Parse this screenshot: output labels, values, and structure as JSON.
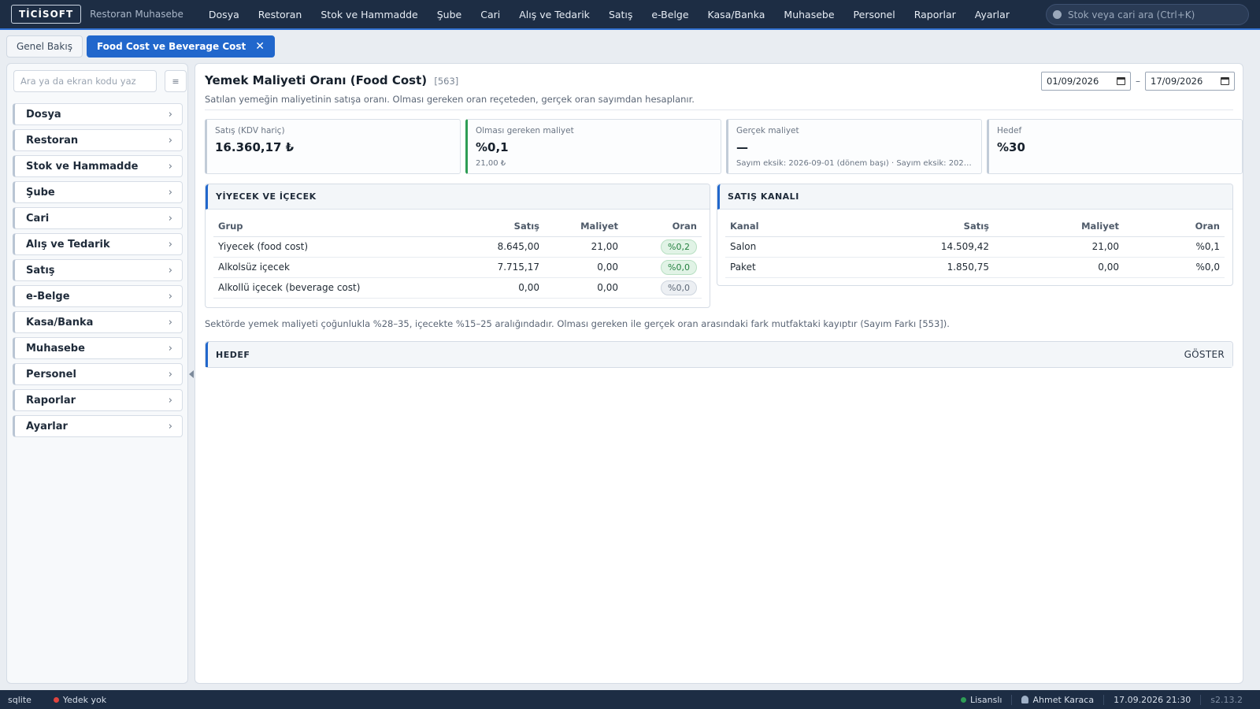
{
  "app": {
    "logo": "TİCİSOFT",
    "subtitle": "Restoran Muhasebe"
  },
  "topnav": [
    "Dosya",
    "Restoran",
    "Stok ve Hammadde",
    "Şube",
    "Cari",
    "Alış ve Tedarik",
    "Satış",
    "e-Belge",
    "Kasa/Banka",
    "Muhasebe",
    "Personel",
    "Raporlar",
    "Ayarlar"
  ],
  "search": {
    "placeholder": "Stok veya cari ara (Ctrl+K)"
  },
  "tabs": {
    "overview": "Genel Bakış",
    "active": "Food Cost ve Beverage Cost",
    "close": "✕"
  },
  "sidebar": {
    "search_placeholder": "Ara ya da ekran kodu yaz",
    "items": [
      "Dosya",
      "Restoran",
      "Stok ve Hammadde",
      "Şube",
      "Cari",
      "Alış ve Tedarik",
      "Satış",
      "e-Belge",
      "Kasa/Banka",
      "Muhasebe",
      "Personel",
      "Raporlar",
      "Ayarlar"
    ]
  },
  "page": {
    "title": "Yemek Maliyeti Oranı (Food Cost)",
    "code": "[563]",
    "subtitle": "Satılan yemeğin maliyetinin satışa oranı. Olması gereken oran reçeteden, gerçek oran sayımdan hesaplanır.",
    "date_from": "01/09/2026",
    "date_to": "17/09/2026",
    "date_sep": "–"
  },
  "kpis": [
    {
      "label": "Satış (KDV hariç)",
      "value": "16.360,17 ₺",
      "note": ""
    },
    {
      "label": "Olması gereken maliyet",
      "value": "%0,1",
      "note": "21,00 ₺"
    },
    {
      "label": "Gerçek maliyet",
      "value": "—",
      "note": "Sayım eksik: 2026-09-01 (dönem başı) · Sayım eksik: 2026-..."
    },
    {
      "label": "Hedef",
      "value": "%30",
      "note": ""
    }
  ],
  "food_table": {
    "title": "YİYECEK VE İÇECEK",
    "headers": [
      "Grup",
      "Satış",
      "Maliyet",
      "Oran"
    ],
    "rows": [
      {
        "group": "Yiyecek (food cost)",
        "sales": "8.645,00",
        "cost": "21,00",
        "ratio": "%0,2"
      },
      {
        "group": "Alkolsüz içecek",
        "sales": "7.715,17",
        "cost": "0,00",
        "ratio": "%0,0"
      },
      {
        "group": "Alkollü içecek (beverage cost)",
        "sales": "0,00",
        "cost": "0,00",
        "ratio": "%0,0"
      }
    ]
  },
  "channel_table": {
    "title": "SATIŞ KANALI",
    "headers": [
      "Kanal",
      "Satış",
      "Maliyet",
      "Oran"
    ],
    "rows": [
      {
        "channel": "Salon",
        "sales": "14.509,42",
        "cost": "21,00",
        "ratio": "%0,1"
      },
      {
        "channel": "Paket",
        "sales": "1.850,75",
        "cost": "0,00",
        "ratio": "%0,0"
      }
    ]
  },
  "note": "Sektörde yemek maliyeti çoğunlukla %28–35, içecekte %15–25 aralığındadır. Olması gereken ile gerçek oran arasındaki fark mutfaktaki kayıptır (Sayım Farkı [553]).",
  "target_section": {
    "title": "HEDEF",
    "toggle": "GÖSTER"
  },
  "status": {
    "db": "sqlite",
    "backup": "Yedek yok",
    "license": "Lisanslı",
    "user": "Ahmet Karaca",
    "datetime": "17.09.2026 21:30",
    "version": "s2.13.2"
  },
  "colors": {
    "accent": "#2167cc",
    "topbar": "#1d2d44",
    "ok": "#2e9d55",
    "error": "#e0443e"
  }
}
